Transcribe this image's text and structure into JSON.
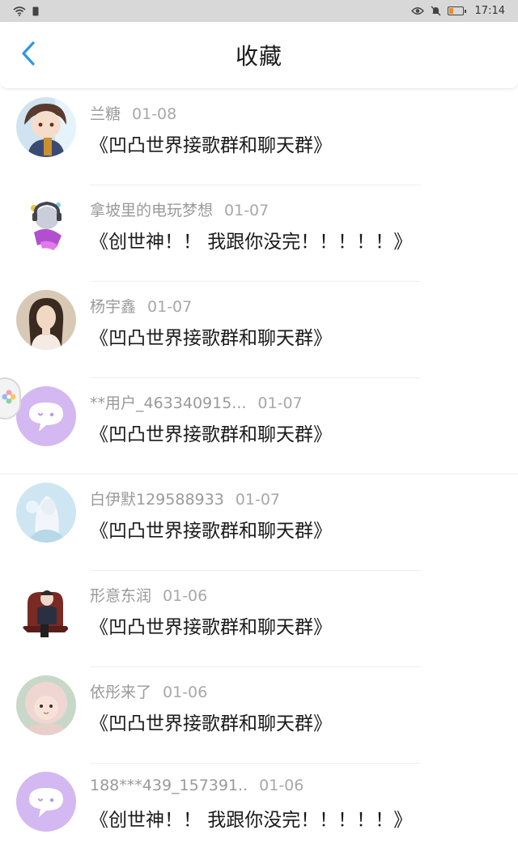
{
  "status_bar": {
    "time": "17:14",
    "icons": [
      "wifi-icon",
      "sim-icon",
      "eye-icon",
      "mute-icon",
      "battery-icon"
    ],
    "battery_color": "#f08a1c"
  },
  "header": {
    "title": "收藏",
    "back_icon": "chevron-left-icon",
    "accent": "#2e96e8"
  },
  "favorites": [
    {
      "name": "兰糖",
      "date": "01-08",
      "message": "《凹凸世界接歌群和聊天群》",
      "avatar": "anime-boy"
    },
    {
      "name": "拿坡里的电玩梦想",
      "date": "01-07",
      "message": "《创世神！！ 我跟你没完！！！！！》",
      "avatar": "anime-girl-headphones"
    },
    {
      "name": "杨宇鑫",
      "date": "01-07",
      "message": "《凹凸世界接歌群和聊天群》",
      "avatar": "photo-woman"
    },
    {
      "name": "**用户_463340915...",
      "date": "01-07",
      "message": "《凹凸世界接歌群和聊天群》",
      "avatar": "default-chat"
    },
    {
      "name": "白伊默129588933",
      "date": "01-07",
      "message": "《凹凸世界接歌群和聊天群》",
      "avatar": "white-hair-figure"
    },
    {
      "name": "形意东润",
      "date": "01-06",
      "message": "《凹凸世界接歌群和聊天群》",
      "avatar": "seated-figure"
    },
    {
      "name": "依彤来了",
      "date": "01-06",
      "message": "《凹凸世界接歌群和聊天群》",
      "avatar": "baby-photo"
    },
    {
      "name": "188***439_157391..",
      "date": "01-06",
      "message": "《创世神！！ 我跟你没完！！！！！》",
      "avatar": "default-chat"
    }
  ]
}
